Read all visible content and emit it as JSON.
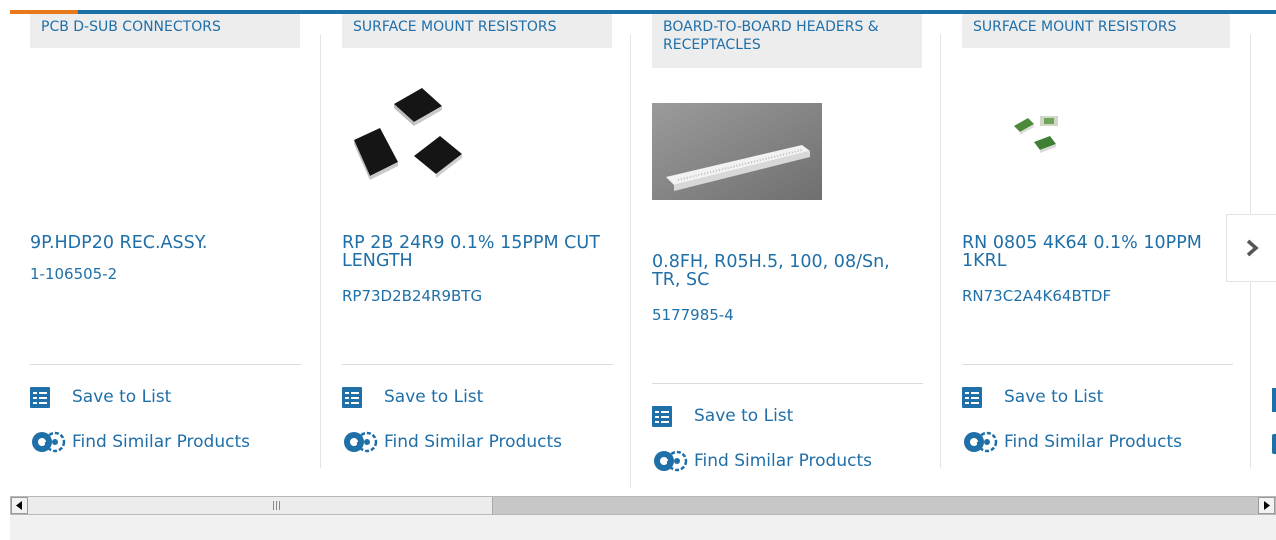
{
  "products": [
    {
      "category": "PCB D-SUB CONNECTORS",
      "name": "9P.HDP20 REC.ASSY.",
      "part_number": "1-106505-2",
      "image": "none"
    },
    {
      "category": "SURFACE MOUNT RESISTORS",
      "name": "RP 2B 24R9 0.1% 15PPM CUT LENGTH",
      "part_number": "RP73D2B24R9BTG",
      "image": "black-chip-resistors"
    },
    {
      "category": "BOARD-TO-BOARD HEADERS & RECEPTACLES",
      "name": "0.8FH, R05H.5, 100, 08/Sn, TR, SC",
      "part_number": "5177985-4",
      "image": "white-board-connector"
    },
    {
      "category": "SURFACE MOUNT RESISTORS",
      "name": "RN 0805 4K64 0.1% 10PPM 1KRL",
      "part_number": "RN73C2A4K64BTDF",
      "image": "green-chip-resistors"
    }
  ],
  "actions": {
    "save_label": "Save to List",
    "similar_label": "Find Similar Products"
  },
  "icons": {
    "save": "checklist-icon",
    "similar": "gears-icon",
    "next": "chevron-right-icon"
  },
  "colors": {
    "link": "#1f6fa8",
    "top_bar": "#1a6fa6",
    "top_accent": "#e8781b",
    "category_bg": "#ededed"
  }
}
